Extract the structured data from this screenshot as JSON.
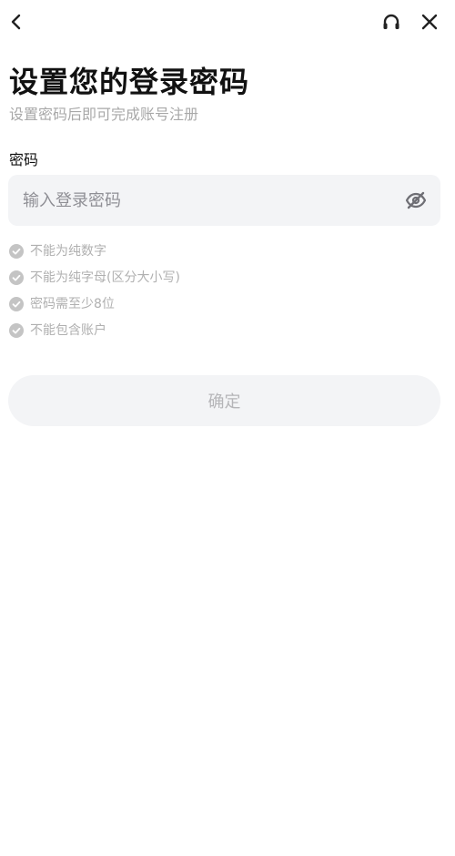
{
  "header": {
    "back_icon": "chevron-left-icon",
    "support_icon": "headset-icon",
    "close_icon": "close-icon"
  },
  "title": "设置您的登录密码",
  "subtitle": "设置密码后即可完成账号注册",
  "password_field": {
    "label": "密码",
    "placeholder": "输入登录密码",
    "value": "",
    "visibility_icon": "eye-off-icon"
  },
  "rules": [
    {
      "text": "不能为纯数字",
      "icon": "check-circle-icon"
    },
    {
      "text": "不能为纯字母(区分大小写)",
      "icon": "check-circle-icon"
    },
    {
      "text": "密码需至少8位",
      "icon": "check-circle-icon"
    },
    {
      "text": "不能包含账户",
      "icon": "check-circle-icon"
    }
  ],
  "confirm_button": {
    "label": "确定",
    "enabled": false
  },
  "colors": {
    "text_primary": "#111111",
    "text_secondary": "#a8a8a8",
    "input_bg": "#f3f4f6",
    "rule_icon": "#c4c4c4",
    "button_disabled_text": "#b5b5b8"
  }
}
